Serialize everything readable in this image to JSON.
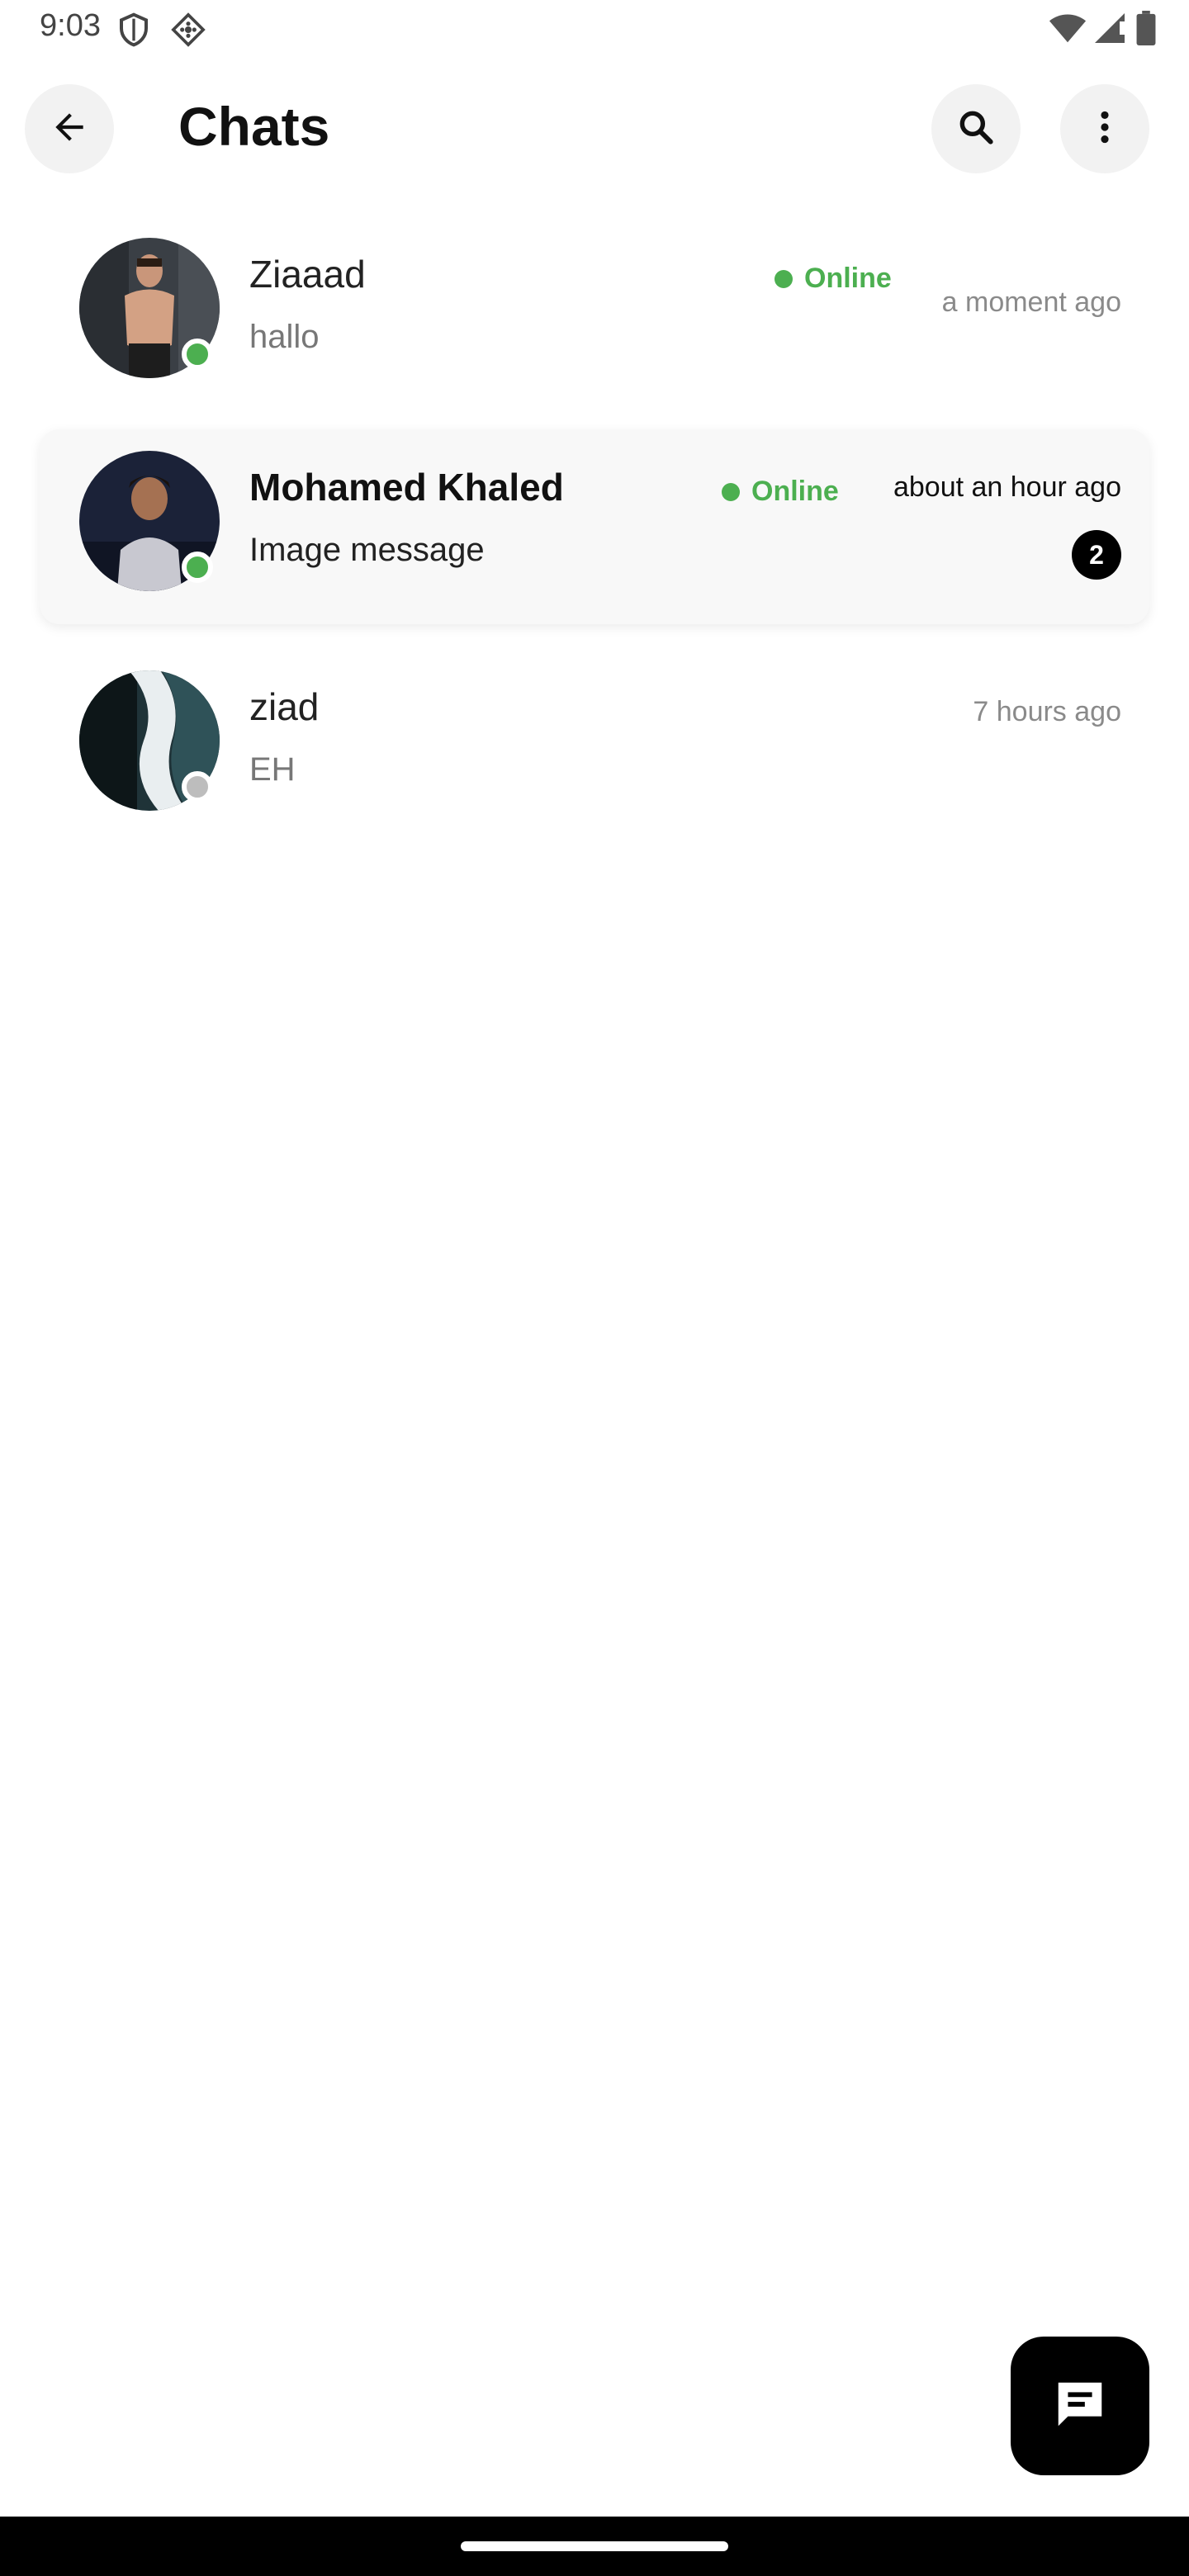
{
  "status_bar": {
    "time": "9:03",
    "icons": [
      "shield-icon",
      "vpn-diamond-icon",
      "wifi-icon",
      "signal-icon",
      "battery-icon"
    ]
  },
  "app_bar": {
    "title": "Chats",
    "back_icon": "arrow-back-icon",
    "search_icon": "search-icon",
    "more_icon": "more-vert-icon"
  },
  "chats": [
    {
      "name": "Ziaaad",
      "preview": "hallo",
      "status": "Online",
      "online": true,
      "time": "a moment ago",
      "unread": null,
      "highlighted": false
    },
    {
      "name": "Mohamed Khaled",
      "preview": "Image message",
      "status": "Online",
      "online": true,
      "time": "about an hour ago",
      "unread": "2",
      "highlighted": true
    },
    {
      "name": "ziad",
      "preview": "EH",
      "status": "",
      "online": false,
      "time": "7 hours ago",
      "unread": null,
      "highlighted": false
    }
  ],
  "fab": {
    "icon": "chat-bubble-icon"
  },
  "colors": {
    "online": "#4caf50",
    "offline": "#bdbdbd",
    "accent": "#000000",
    "muted_text": "#8a8a8a"
  }
}
